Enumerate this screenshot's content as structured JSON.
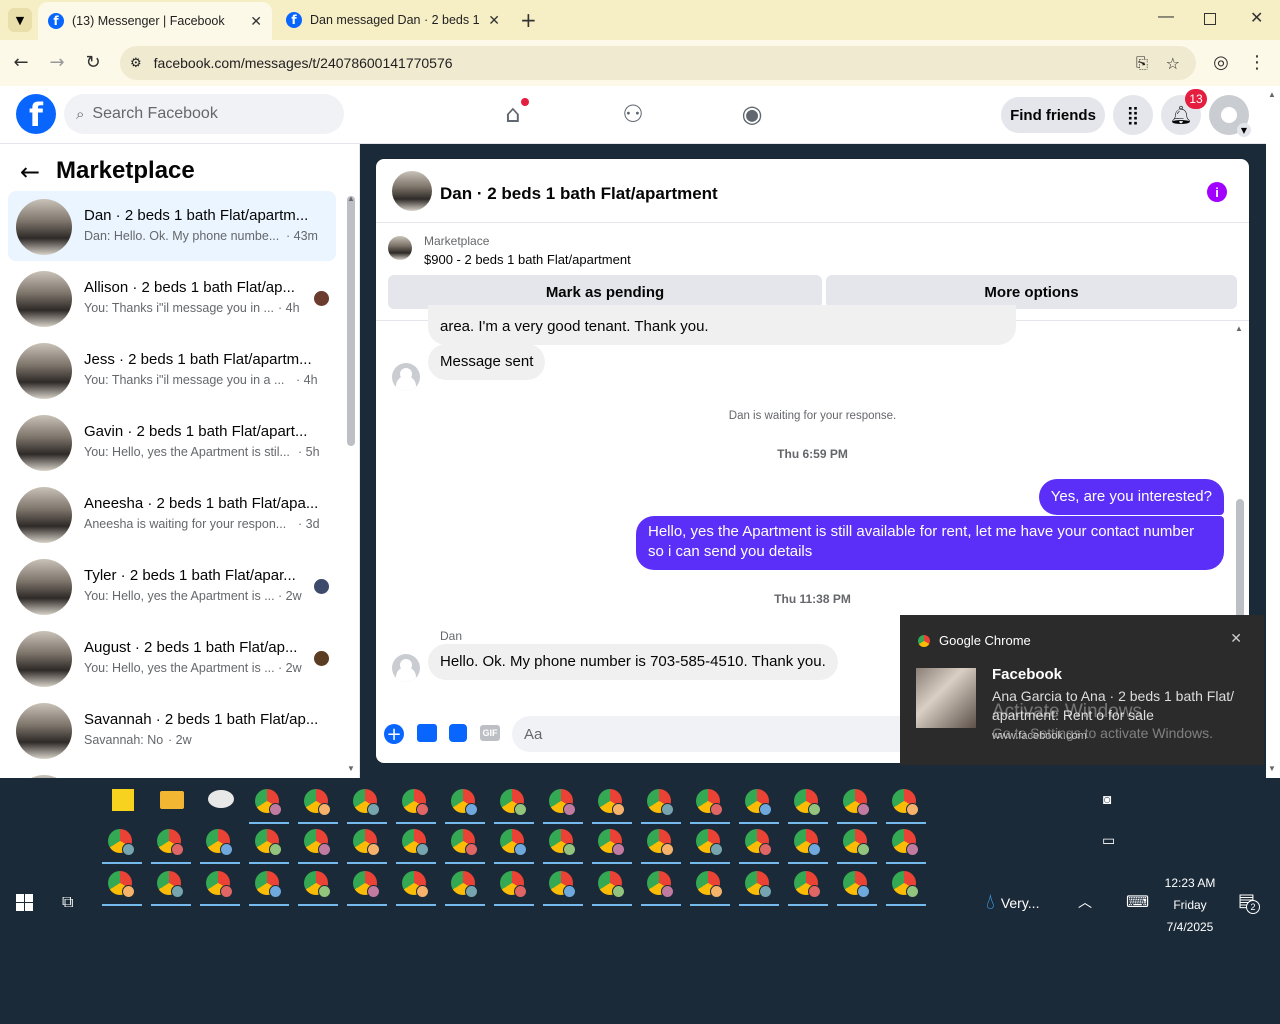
{
  "browser": {
    "tabs": [
      {
        "title": "(13) Messenger | Facebook"
      },
      {
        "title": "Dan messaged Dan · 2 beds 1 b"
      }
    ],
    "url": "facebook.com/messages/t/24078600141770576"
  },
  "header": {
    "search_placeholder": "Search Facebook",
    "find_friends": "Find friends",
    "notification_count": "13"
  },
  "sidebar": {
    "title": "Marketplace",
    "conversations": [
      {
        "title": "Dan · 2 beds 1 bath Flat/apartm...",
        "preview": "Dan: Hello. Ok. My phone numbe...",
        "time": "· 43m"
      },
      {
        "title": "Allison · 2 beds 1 bath Flat/ap...",
        "preview": "You: Thanks i\"il message you in ...",
        "time": "· 4h"
      },
      {
        "title": "Jess · 2 beds 1 bath Flat/apartm...",
        "preview": "You: Thanks i\"il message you in a ...",
        "time": "· 4h"
      },
      {
        "title": "Gavin · 2 beds 1 bath Flat/apart...",
        "preview": "You: Hello, yes the Apartment is stil...",
        "time": "· 5h"
      },
      {
        "title": "Aneesha · 2 beds 1 bath Flat/apa...",
        "preview": "Aneesha is waiting for your respon...",
        "time": "· 3d"
      },
      {
        "title": "Tyler · 2 beds 1 bath Flat/apar...",
        "preview": "You: Hello, yes the Apartment is ...",
        "time": "· 2w"
      },
      {
        "title": "August · 2 beds 1 bath Flat/ap...",
        "preview": "You: Hello, yes the Apartment is ...",
        "time": "· 2w"
      },
      {
        "title": "Savannah · 2 beds 1 bath Flat/ap...",
        "preview": "Savannah: No",
        "time": "· 2w"
      }
    ]
  },
  "chat": {
    "title": "Dan · 2 beds 1 bath Flat/apartment",
    "listing_source": "Marketplace",
    "listing": "$900 - 2 beds 1 bath Flat/apartment",
    "mark_pending": "Mark as pending",
    "more_options": "More options",
    "msg_partial": "area. I'm a very good tenant. Thank you.",
    "msg_sent": "Message sent",
    "waiting": "Dan is waiting for your response.",
    "time1": "Thu 6:59 PM",
    "out1": "Yes, are you interested?",
    "out2": "Hello, yes the Apartment is still available for rent, let me have your contact number so i can send you details",
    "time2": "Thu 11:38 PM",
    "sender": "Dan",
    "in_last": "Hello. Ok. My phone number is 703-585-4510. Thank you.",
    "input_placeholder": "Aa",
    "gif_label": "GIF"
  },
  "notification": {
    "app": "Google Chrome",
    "title": "Facebook",
    "body": "Ana Garcia to Ana · 2 beds 1 bath Flat/ apartment: Rent o for sale",
    "source": "www.facebook.com",
    "watermark1": "Activate Windows",
    "watermark2": "Go to Settings to activate Windows."
  },
  "taskbar": {
    "weather": "Very...",
    "time": "12:23 AM",
    "day": "Friday",
    "date": "7/4/2025",
    "action_center_count": "2"
  },
  "colors": {
    "fb_blue": "#0866ff",
    "outgoing_bubble": "#5b2ff7",
    "notif_red": "#e41e3f"
  }
}
